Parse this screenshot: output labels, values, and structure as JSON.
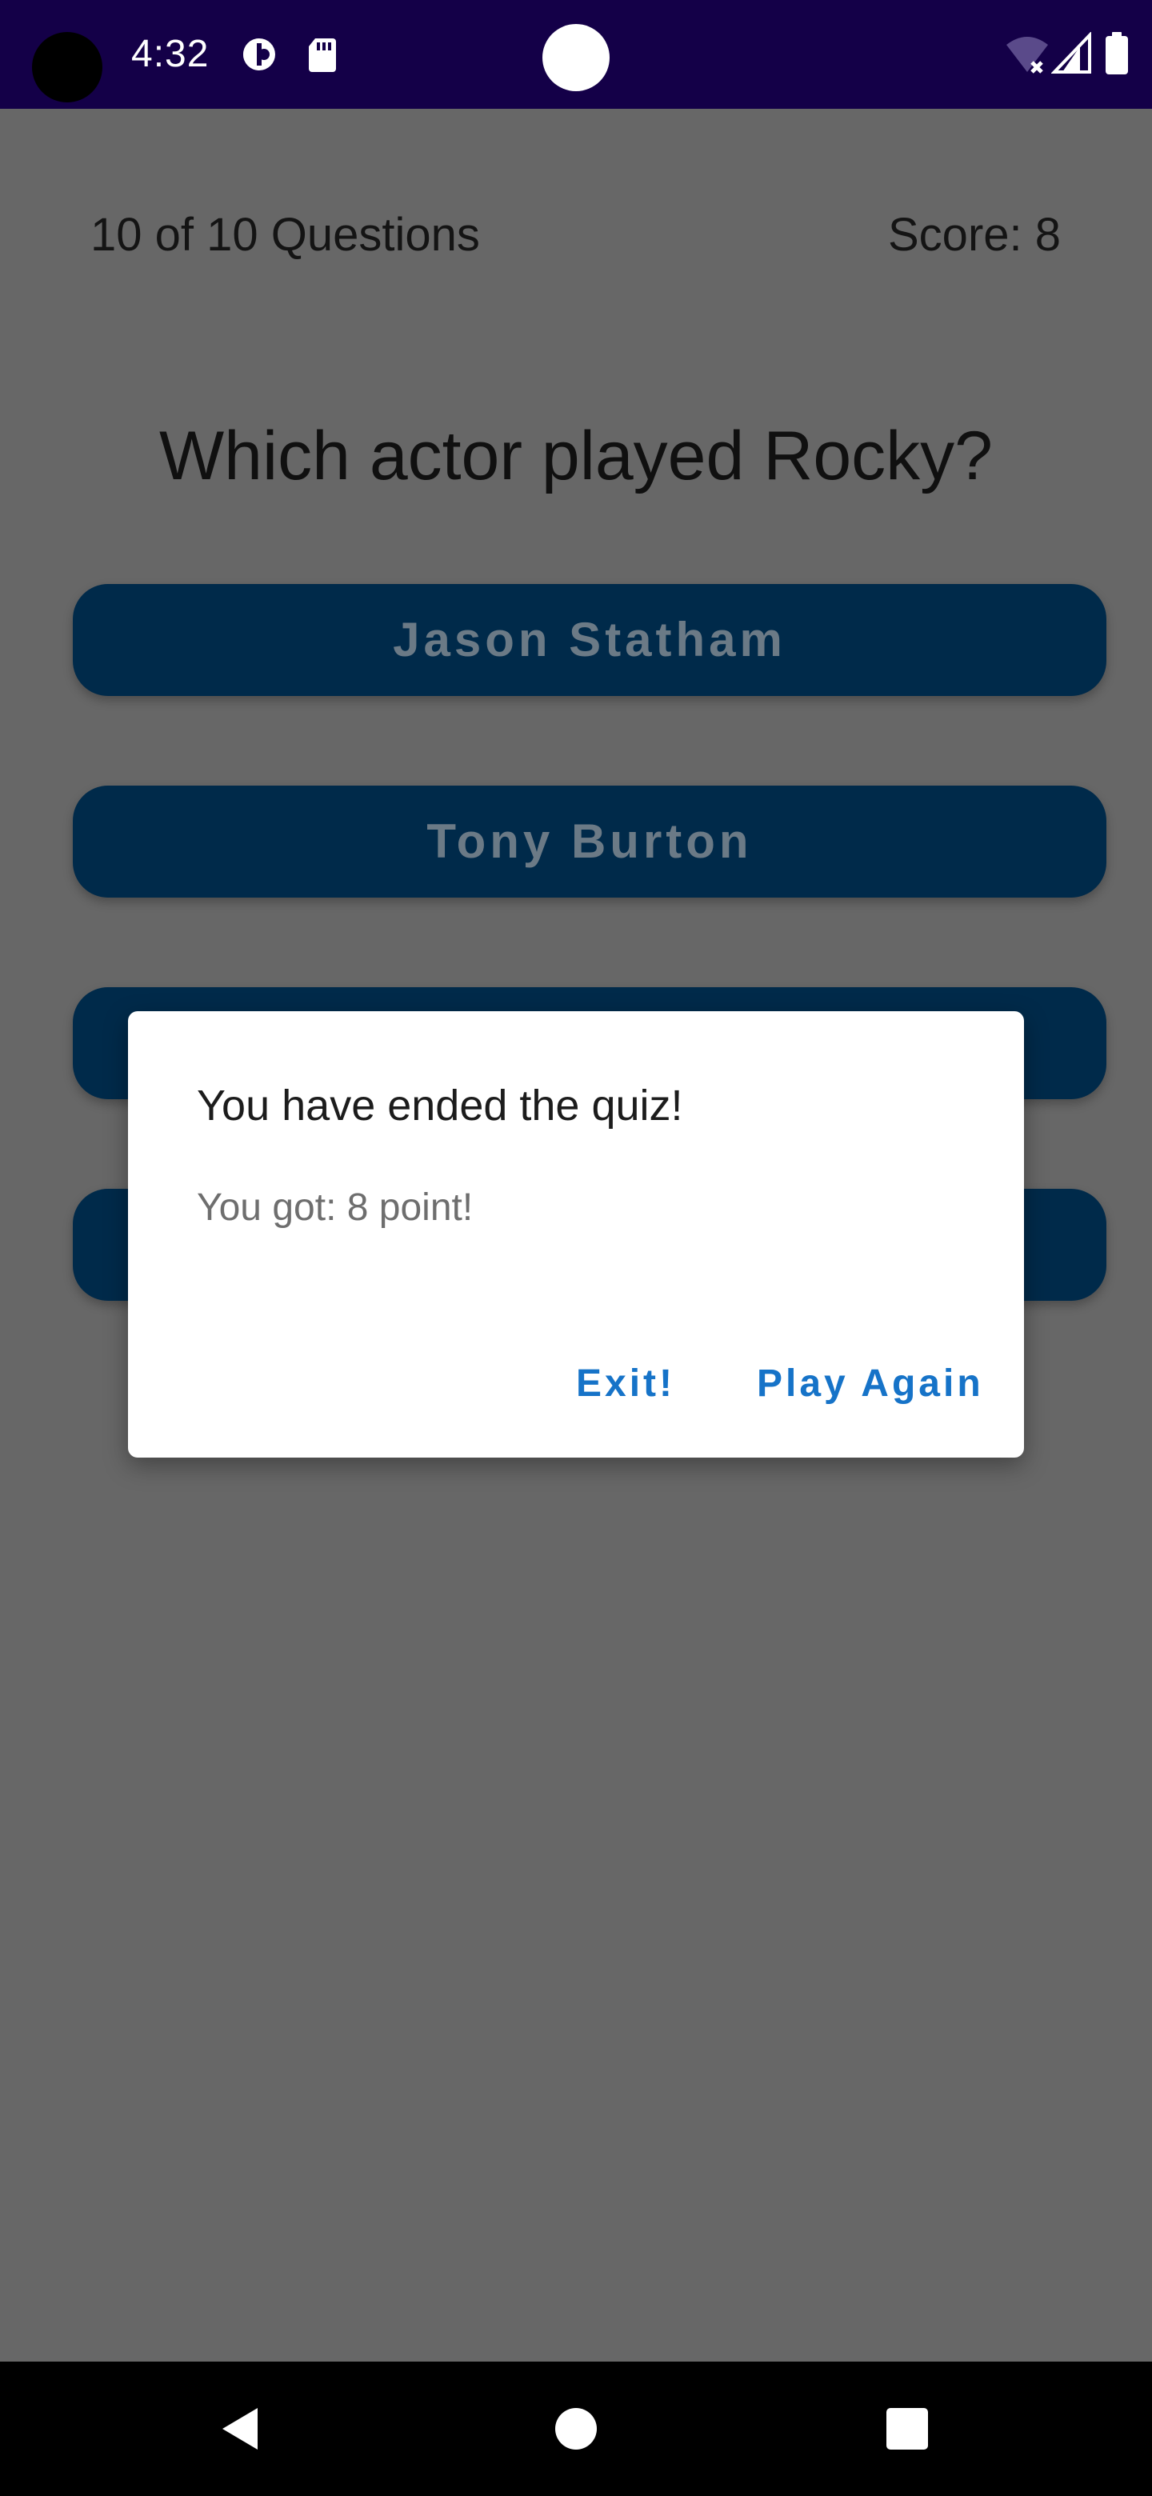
{
  "status_bar": {
    "time": "4:32",
    "icons": [
      "camera-cutout",
      "data-saver-icon",
      "sd-card-icon",
      "wifi-off-icon",
      "cell-signal-icon",
      "battery-icon"
    ]
  },
  "quiz": {
    "progress": "10 of 10 Questions",
    "score": "Score: 8",
    "question": "Which actor played Rocky?",
    "answers": [
      "Jason Statham",
      "Tony Burton",
      "",
      ""
    ]
  },
  "dialog": {
    "title": "You have ended the quiz!",
    "message": "You got:  8 point!",
    "exit_label": "Exit!",
    "play_again_label": "Play Again"
  },
  "nav_bar": {
    "icons": [
      "back-icon",
      "home-icon",
      "recents-icon"
    ]
  },
  "colors": {
    "status_bar": "#140048",
    "scrim_background": "#676767",
    "answer_button": "#002a4a",
    "dialog_action": "#1673c8",
    "nav_bar": "#000000"
  }
}
